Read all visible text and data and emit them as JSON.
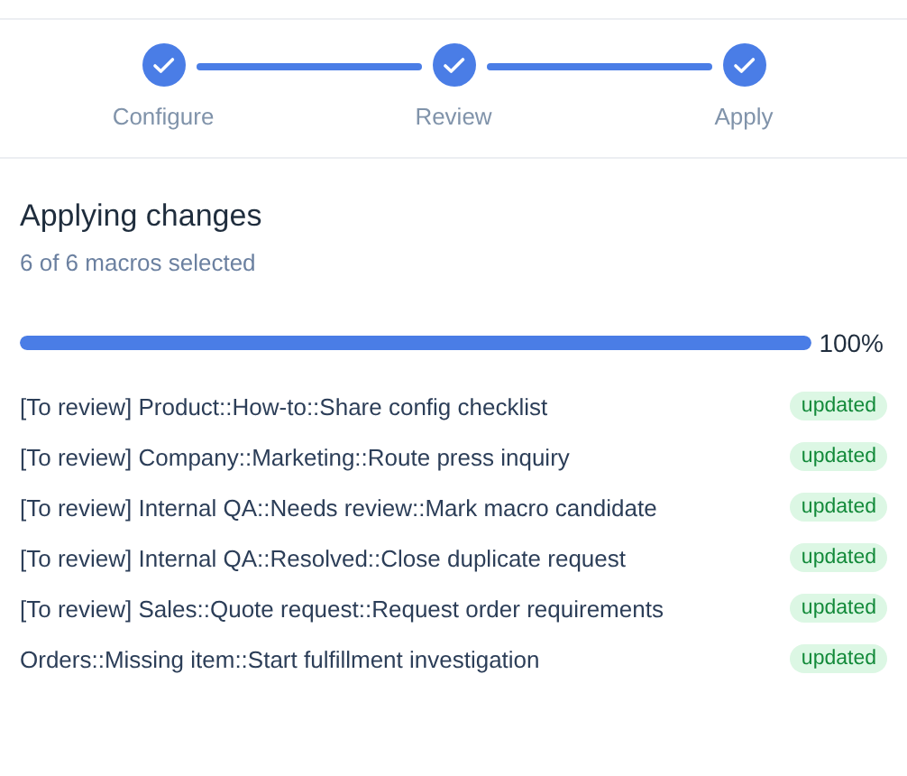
{
  "steps": [
    {
      "label": "Configure",
      "completed": true
    },
    {
      "label": "Review",
      "completed": true
    },
    {
      "label": "Apply",
      "completed": true
    }
  ],
  "title": "Applying changes",
  "subtitle": "6 of 6 macros selected",
  "progress": {
    "level": 1,
    "reading": "100%"
  },
  "macros": [
    {
      "name": "[To review] Product::How-to::Share config checklist",
      "status": "updated"
    },
    {
      "name": "[To review] Company::Marketing::Route press inquiry",
      "status": "updated"
    },
    {
      "name": "[To review] Internal QA::Needs review::Mark macro candidate",
      "status": "updated"
    },
    {
      "name": "[To review] Internal QA::Resolved::Close duplicate request",
      "status": "updated"
    },
    {
      "name": "[To review] Sales::Quote request::Request order requirements",
      "status": "updated"
    },
    {
      "name": "Orders::Missing item::Start fulfillment investigation",
      "status": "updated"
    }
  ]
}
